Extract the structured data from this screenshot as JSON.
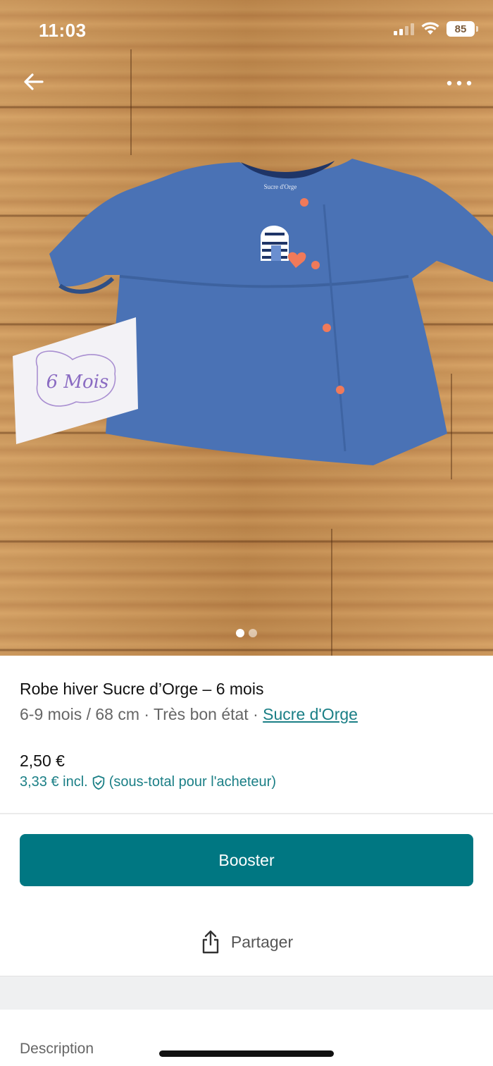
{
  "status_bar": {
    "time": "11:03",
    "battery": "85"
  },
  "photo": {
    "tag_text": "6 Mois",
    "label_text": "Sucre d'Orge",
    "pager": {
      "total": 2,
      "active": 1
    }
  },
  "item": {
    "title": "Robe hiver Sucre d’Orge – 6 mois",
    "size": "6-9 mois / 68 cm",
    "separator": " · ",
    "condition": "Très bon état",
    "brand": "Sucre d'Orge",
    "price": "2,50 €",
    "price_incl": "3,33 € incl.",
    "price_incl_note": "(sous-total pour l'acheteur)"
  },
  "actions": {
    "booster_label": "Booster",
    "share_label": "Partager"
  },
  "sections": {
    "description_label": "Description"
  },
  "colors": {
    "accent": "#007782",
    "link": "#1b7f86",
    "garment": "#4a72b5",
    "button_on_garment": "#f07a5a"
  },
  "icons": {
    "back": "arrow-left-icon",
    "more": "more-dots-icon",
    "share": "share-icon",
    "shield": "shield-check-icon",
    "signal": "signal-icon",
    "wifi": "wifi-icon",
    "battery": "battery-icon"
  }
}
